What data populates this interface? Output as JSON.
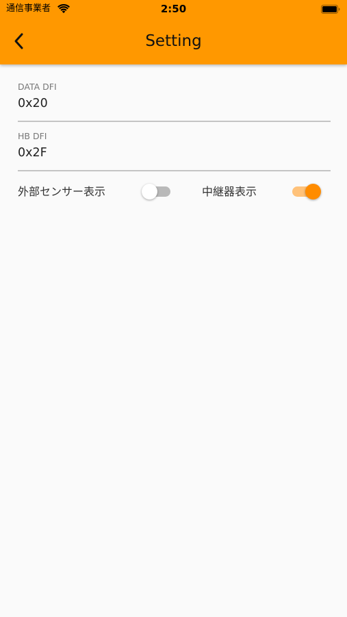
{
  "status_bar": {
    "carrier": "通信事業者",
    "time": "2:50",
    "wifi_icon": "wifi-icon",
    "battery_icon": "battery-icon"
  },
  "header": {
    "title": "Setting",
    "back_icon": "chevron-left-icon",
    "background": "#ff9800"
  },
  "fields": [
    {
      "label": "DATA DFI",
      "value": "0x20"
    },
    {
      "label": "HB DFI",
      "value": "0x2F"
    }
  ],
  "toggles": {
    "external_sensor": {
      "label": "外部センサー表示",
      "on": false
    },
    "repeater": {
      "label": "中継器表示",
      "on": true
    }
  },
  "colors": {
    "accent": "#ff8c00",
    "accent_track": "#ffc27a",
    "off_track": "#b9b9b9",
    "background": "#fafafa"
  }
}
